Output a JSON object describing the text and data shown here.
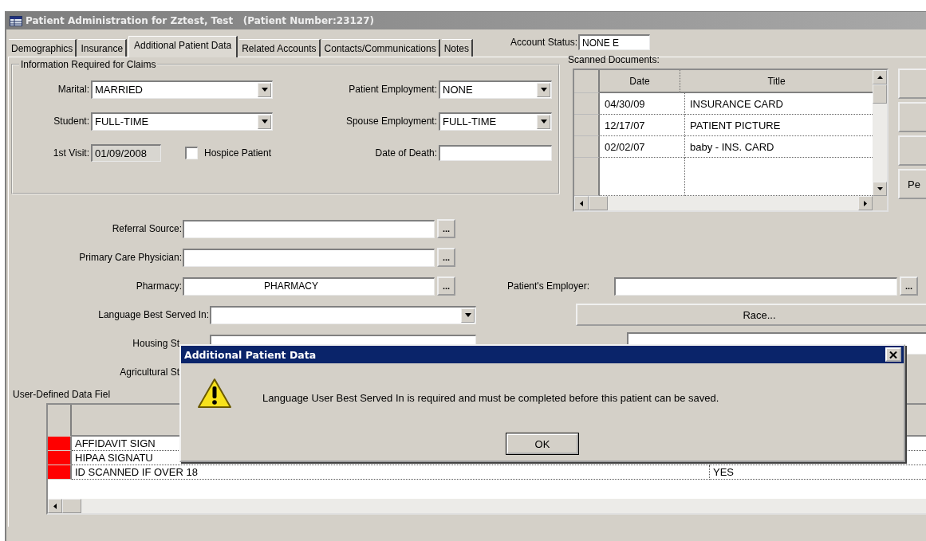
{
  "window": {
    "title": "Patient Administration for Zztest, Test   (Patient Number:23127)"
  },
  "tabs": [
    {
      "label": "Demographics",
      "selected": false
    },
    {
      "label": "Insurance",
      "selected": false
    },
    {
      "label": "Additional Patient Data",
      "selected": true
    },
    {
      "label": "Related Accounts",
      "selected": false
    },
    {
      "label": "Contacts/Communications",
      "selected": false
    },
    {
      "label": "Notes",
      "selected": false
    }
  ],
  "account_status": {
    "label": "Account Status:",
    "value": "NONE E"
  },
  "claims": {
    "title": "Information Required for Claims",
    "rows": [
      [
        {
          "kind": "dropdown",
          "label": "Marital:",
          "value": "MARRIED"
        },
        {
          "kind": "dropdown",
          "label": "Patient Employment:",
          "value": "NONE"
        }
      ],
      [
        {
          "kind": "dropdown",
          "label": "Student:",
          "value": "FULL-TIME"
        },
        {
          "kind": "dropdown",
          "label": "Spouse Employment:",
          "value": "FULL-TIME"
        }
      ],
      [
        {
          "kind": "date",
          "label": "1st Visit:",
          "value": "01/09/2008"
        },
        {
          "kind": "checkbox",
          "label": "Hospice Patient",
          "checked": false
        },
        {
          "kind": "text",
          "label": "Date of Death:"
        }
      ]
    ]
  },
  "scanned_documents": {
    "label": "Scanned Documents:",
    "columns": [
      "Date",
      "Title"
    ],
    "rows": [
      {
        "date": "04/30/09",
        "title": "INSURANCE CARD"
      },
      {
        "date": "12/17/07",
        "title": "PATIENT PICTURE"
      },
      {
        "date": "02/02/07",
        "title": "baby - INS. CARD"
      }
    ],
    "side_buttons": [
      {
        "kind": "blank"
      },
      {
        "kind": "blank"
      },
      {
        "kind": "blank"
      },
      {
        "kind": "label",
        "label": "Pe"
      }
    ]
  },
  "lower_rows": [
    {
      "left": {
        "kind": "lookup",
        "label": "Referral Source:",
        "button": "..."
      }
    },
    {
      "left": {
        "kind": "lookup",
        "label": "Primary Care Physician:",
        "button": "..."
      }
    },
    {
      "left": {
        "kind": "lookup",
        "label": "Pharmacy:",
        "value": "PHARMACY",
        "button": "..."
      },
      "right": {
        "kind": "lookup",
        "label": "Patient's Employer:",
        "button": "..."
      }
    },
    {
      "left": {
        "kind": "dropdown",
        "label": "Language Best Served In:"
      },
      "right": {
        "kind": "button",
        "label": "Race..."
      }
    },
    {
      "left": {
        "kind": "dropdown_cut",
        "label": "Housing St"
      },
      "right": {
        "kind": "field"
      }
    },
    {
      "left": {
        "kind": "label_cut",
        "label": "Agricultural St"
      }
    }
  ],
  "user_fields": {
    "label": "User-Defined Data Fiel",
    "rows": [
      {
        "name": "AFFIDAVIT SIGN",
        "required": true
      },
      {
        "name": "HIPAA SIGNATU",
        "required": true
      },
      {
        "name": "ID SCANNED IF OVER 18",
        "value": "YES",
        "required": true
      }
    ]
  },
  "dialog": {
    "title": "Additional Patient Data",
    "message": "Language User Best Served In is required and must be completed before this patient can be saved.",
    "button": "OK"
  }
}
